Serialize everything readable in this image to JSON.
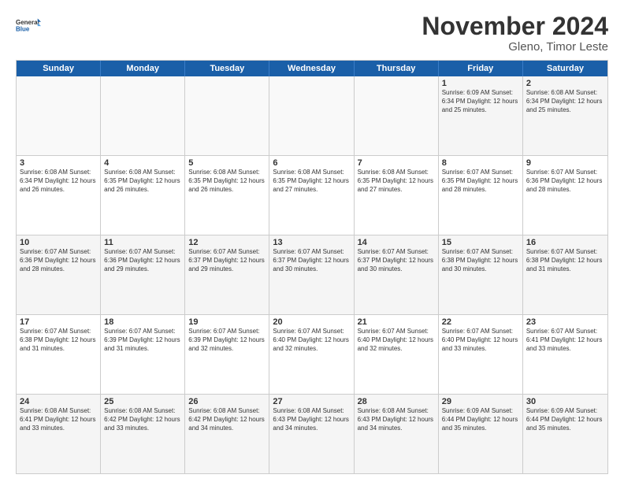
{
  "logo": {
    "line1": "General",
    "line2": "Blue"
  },
  "title": "November 2024",
  "subtitle": "Gleno, Timor Leste",
  "days": [
    "Sunday",
    "Monday",
    "Tuesday",
    "Wednesday",
    "Thursday",
    "Friday",
    "Saturday"
  ],
  "weeks": [
    [
      {
        "day": "",
        "info": ""
      },
      {
        "day": "",
        "info": ""
      },
      {
        "day": "",
        "info": ""
      },
      {
        "day": "",
        "info": ""
      },
      {
        "day": "",
        "info": ""
      },
      {
        "day": "1",
        "info": "Sunrise: 6:09 AM\nSunset: 6:34 PM\nDaylight: 12 hours and 25 minutes."
      },
      {
        "day": "2",
        "info": "Sunrise: 6:08 AM\nSunset: 6:34 PM\nDaylight: 12 hours and 25 minutes."
      }
    ],
    [
      {
        "day": "3",
        "info": "Sunrise: 6:08 AM\nSunset: 6:34 PM\nDaylight: 12 hours and 26 minutes."
      },
      {
        "day": "4",
        "info": "Sunrise: 6:08 AM\nSunset: 6:35 PM\nDaylight: 12 hours and 26 minutes."
      },
      {
        "day": "5",
        "info": "Sunrise: 6:08 AM\nSunset: 6:35 PM\nDaylight: 12 hours and 26 minutes."
      },
      {
        "day": "6",
        "info": "Sunrise: 6:08 AM\nSunset: 6:35 PM\nDaylight: 12 hours and 27 minutes."
      },
      {
        "day": "7",
        "info": "Sunrise: 6:08 AM\nSunset: 6:35 PM\nDaylight: 12 hours and 27 minutes."
      },
      {
        "day": "8",
        "info": "Sunrise: 6:07 AM\nSunset: 6:35 PM\nDaylight: 12 hours and 28 minutes."
      },
      {
        "day": "9",
        "info": "Sunrise: 6:07 AM\nSunset: 6:36 PM\nDaylight: 12 hours and 28 minutes."
      }
    ],
    [
      {
        "day": "10",
        "info": "Sunrise: 6:07 AM\nSunset: 6:36 PM\nDaylight: 12 hours and 28 minutes."
      },
      {
        "day": "11",
        "info": "Sunrise: 6:07 AM\nSunset: 6:36 PM\nDaylight: 12 hours and 29 minutes."
      },
      {
        "day": "12",
        "info": "Sunrise: 6:07 AM\nSunset: 6:37 PM\nDaylight: 12 hours and 29 minutes."
      },
      {
        "day": "13",
        "info": "Sunrise: 6:07 AM\nSunset: 6:37 PM\nDaylight: 12 hours and 30 minutes."
      },
      {
        "day": "14",
        "info": "Sunrise: 6:07 AM\nSunset: 6:37 PM\nDaylight: 12 hours and 30 minutes."
      },
      {
        "day": "15",
        "info": "Sunrise: 6:07 AM\nSunset: 6:38 PM\nDaylight: 12 hours and 30 minutes."
      },
      {
        "day": "16",
        "info": "Sunrise: 6:07 AM\nSunset: 6:38 PM\nDaylight: 12 hours and 31 minutes."
      }
    ],
    [
      {
        "day": "17",
        "info": "Sunrise: 6:07 AM\nSunset: 6:38 PM\nDaylight: 12 hours and 31 minutes."
      },
      {
        "day": "18",
        "info": "Sunrise: 6:07 AM\nSunset: 6:39 PM\nDaylight: 12 hours and 31 minutes."
      },
      {
        "day": "19",
        "info": "Sunrise: 6:07 AM\nSunset: 6:39 PM\nDaylight: 12 hours and 32 minutes."
      },
      {
        "day": "20",
        "info": "Sunrise: 6:07 AM\nSunset: 6:40 PM\nDaylight: 12 hours and 32 minutes."
      },
      {
        "day": "21",
        "info": "Sunrise: 6:07 AM\nSunset: 6:40 PM\nDaylight: 12 hours and 32 minutes."
      },
      {
        "day": "22",
        "info": "Sunrise: 6:07 AM\nSunset: 6:40 PM\nDaylight: 12 hours and 33 minutes."
      },
      {
        "day": "23",
        "info": "Sunrise: 6:07 AM\nSunset: 6:41 PM\nDaylight: 12 hours and 33 minutes."
      }
    ],
    [
      {
        "day": "24",
        "info": "Sunrise: 6:08 AM\nSunset: 6:41 PM\nDaylight: 12 hours and 33 minutes."
      },
      {
        "day": "25",
        "info": "Sunrise: 6:08 AM\nSunset: 6:42 PM\nDaylight: 12 hours and 33 minutes."
      },
      {
        "day": "26",
        "info": "Sunrise: 6:08 AM\nSunset: 6:42 PM\nDaylight: 12 hours and 34 minutes."
      },
      {
        "day": "27",
        "info": "Sunrise: 6:08 AM\nSunset: 6:43 PM\nDaylight: 12 hours and 34 minutes."
      },
      {
        "day": "28",
        "info": "Sunrise: 6:08 AM\nSunset: 6:43 PM\nDaylight: 12 hours and 34 minutes."
      },
      {
        "day": "29",
        "info": "Sunrise: 6:09 AM\nSunset: 6:44 PM\nDaylight: 12 hours and 35 minutes."
      },
      {
        "day": "30",
        "info": "Sunrise: 6:09 AM\nSunset: 6:44 PM\nDaylight: 12 hours and 35 minutes."
      }
    ]
  ]
}
